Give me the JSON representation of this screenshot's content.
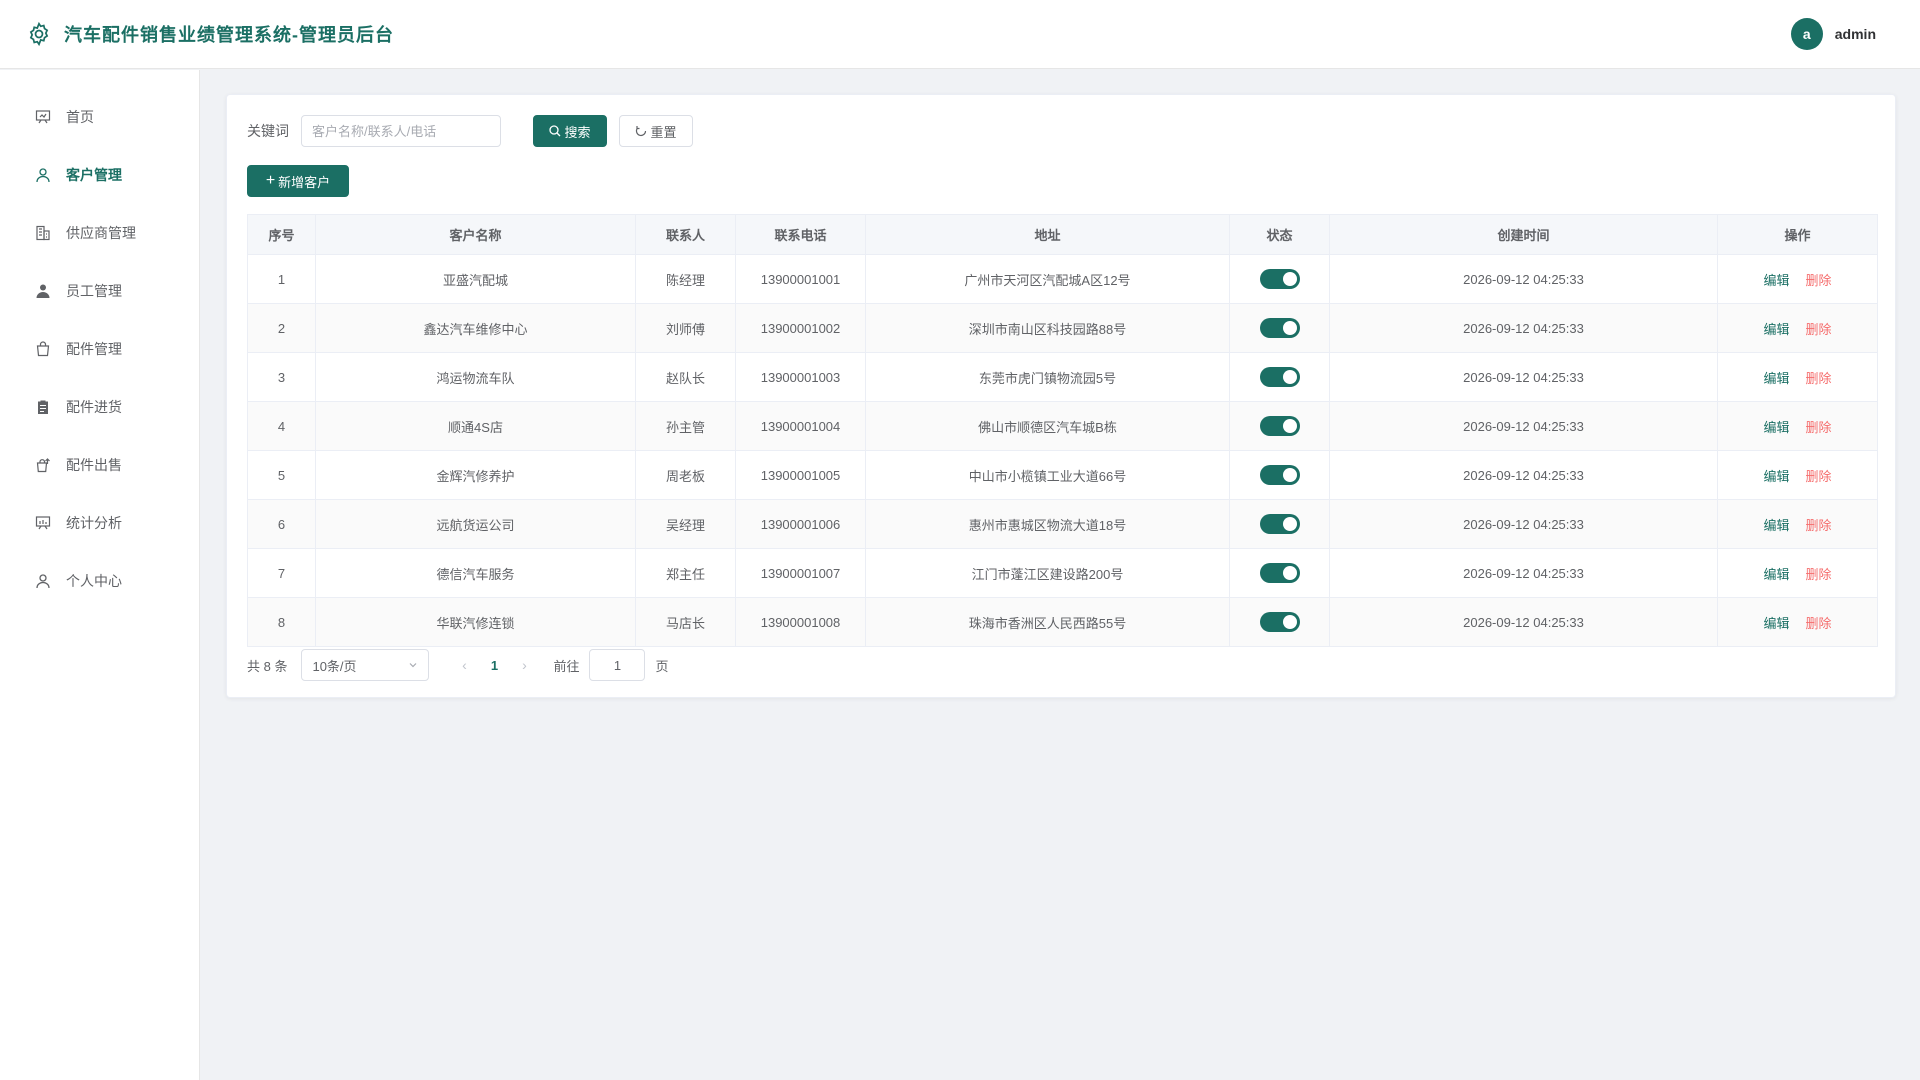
{
  "header": {
    "title": "汽车配件销售业绩管理系统-管理员后台",
    "avatar_letter": "a",
    "username": "admin"
  },
  "sidebar": {
    "items": [
      {
        "label": "首页",
        "icon": "presentation-icon",
        "active": false
      },
      {
        "label": "客户管理",
        "icon": "user-icon",
        "active": true
      },
      {
        "label": "供应商管理",
        "icon": "building-icon",
        "active": false
      },
      {
        "label": "员工管理",
        "icon": "user-filled-icon",
        "active": false
      },
      {
        "label": "配件管理",
        "icon": "shopping-bag-icon",
        "active": false
      },
      {
        "label": "配件进货",
        "icon": "clipboard-icon",
        "active": false
      },
      {
        "label": "配件出售",
        "icon": "sell-icon",
        "active": false
      },
      {
        "label": "统计分析",
        "icon": "chart-board-icon",
        "active": false
      },
      {
        "label": "个人中心",
        "icon": "user-icon",
        "active": false
      }
    ]
  },
  "search": {
    "label": "关键词",
    "placeholder": "客户名称/联系人/电话",
    "value": "",
    "search_button": "搜索",
    "reset_button": "重置"
  },
  "add_button": "新增客户",
  "table": {
    "columns": [
      "序号",
      "客户名称",
      "联系人",
      "联系电话",
      "地址",
      "状态",
      "创建时间",
      "操作"
    ],
    "edit_label": "编辑",
    "delete_label": "删除",
    "rows": [
      {
        "index": "1",
        "name": "亚盛汽配城",
        "contact": "陈经理",
        "phone": "13900001001",
        "address": "广州市天河区汽配城A区12号",
        "status": true,
        "created": "2026-09-12 04:25:33"
      },
      {
        "index": "2",
        "name": "鑫达汽车维修中心",
        "contact": "刘师傅",
        "phone": "13900001002",
        "address": "深圳市南山区科技园路88号",
        "status": true,
        "created": "2026-09-12 04:25:33"
      },
      {
        "index": "3",
        "name": "鸿运物流车队",
        "contact": "赵队长",
        "phone": "13900001003",
        "address": "东莞市虎门镇物流园5号",
        "status": true,
        "created": "2026-09-12 04:25:33"
      },
      {
        "index": "4",
        "name": "顺通4S店",
        "contact": "孙主管",
        "phone": "13900001004",
        "address": "佛山市顺德区汽车城B栋",
        "status": true,
        "created": "2026-09-12 04:25:33"
      },
      {
        "index": "5",
        "name": "金辉汽修养护",
        "contact": "周老板",
        "phone": "13900001005",
        "address": "中山市小榄镇工业大道66号",
        "status": true,
        "created": "2026-09-12 04:25:33"
      },
      {
        "index": "6",
        "name": "远航货运公司",
        "contact": "吴经理",
        "phone": "13900001006",
        "address": "惠州市惠城区物流大道18号",
        "status": true,
        "created": "2026-09-12 04:25:33"
      },
      {
        "index": "7",
        "name": "德信汽车服务",
        "contact": "郑主任",
        "phone": "13900001007",
        "address": "江门市蓬江区建设路200号",
        "status": true,
        "created": "2026-09-12 04:25:33"
      },
      {
        "index": "8",
        "name": "华联汽修连锁",
        "contact": "马店长",
        "phone": "13900001008",
        "address": "珠海市香洲区人民西路55号",
        "status": true,
        "created": "2026-09-12 04:25:33"
      }
    ]
  },
  "pagination": {
    "total_text": "共 8 条",
    "page_size": "10条/页",
    "current_page": "1",
    "goto_label": "前往",
    "goto_value": "1",
    "page_unit": "页"
  },
  "colors": {
    "primary": "#1b6f64",
    "danger": "#f56c6c"
  }
}
